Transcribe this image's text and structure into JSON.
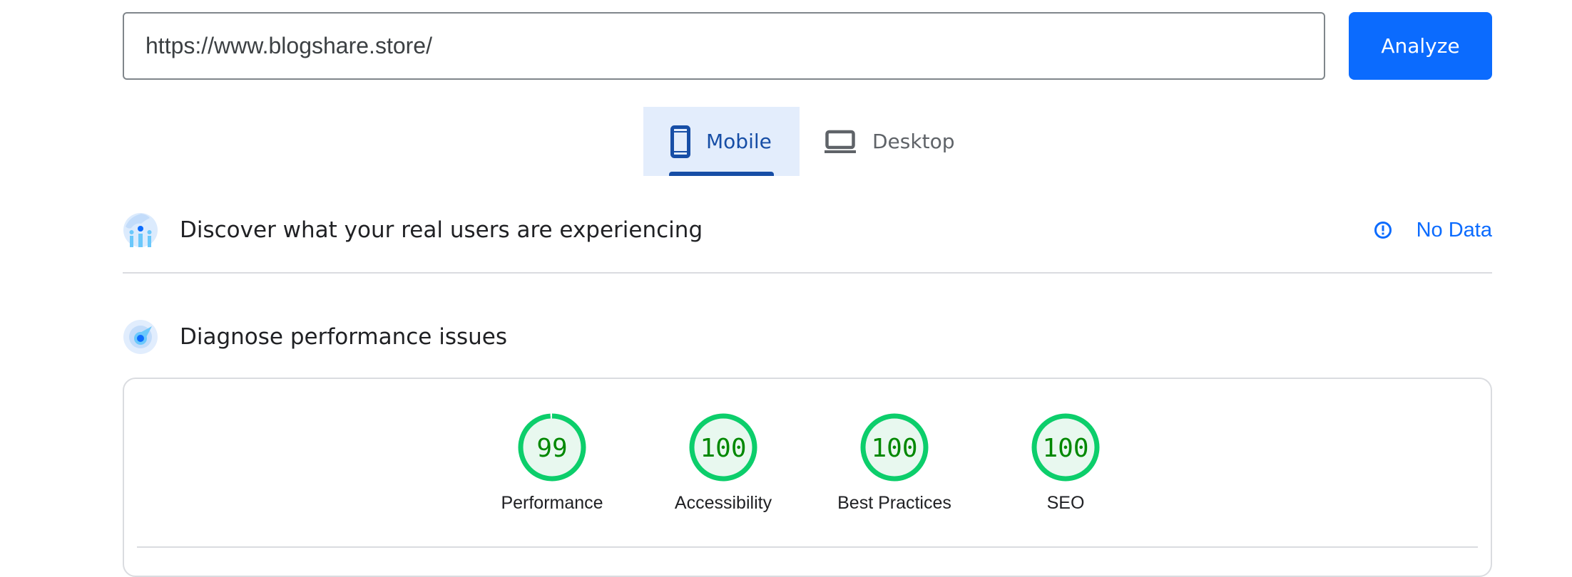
{
  "search": {
    "url_value": "https://www.blogshare.store/",
    "analyze_label": "Analyze"
  },
  "tabs": [
    {
      "label": "Mobile",
      "icon": "smartphone-icon",
      "selected": true
    },
    {
      "label": "Desktop",
      "icon": "laptop-icon",
      "selected": false
    }
  ],
  "crux_section": {
    "icon": "real-users-icon",
    "title": "Discover what your real users are experiencing",
    "status_icon": "info-icon",
    "status_label": "No Data"
  },
  "diagnose_section": {
    "icon": "lighthouse-gauge-icon",
    "title": "Diagnose performance issues"
  },
  "scores": [
    {
      "label": "Performance",
      "value": 99
    },
    {
      "label": "Accessibility",
      "value": 100
    },
    {
      "label": "Best Practices",
      "value": 100
    },
    {
      "label": "SEO",
      "value": 100
    }
  ],
  "colors": {
    "accent": "#0b6bfe",
    "tab_selected_text": "#174ea6",
    "tab_selected_bg": "#e3edfc",
    "score_good_ring": "#0cce6b",
    "score_good_fill": "#e8f8ef",
    "score_good_text": "#008800"
  }
}
